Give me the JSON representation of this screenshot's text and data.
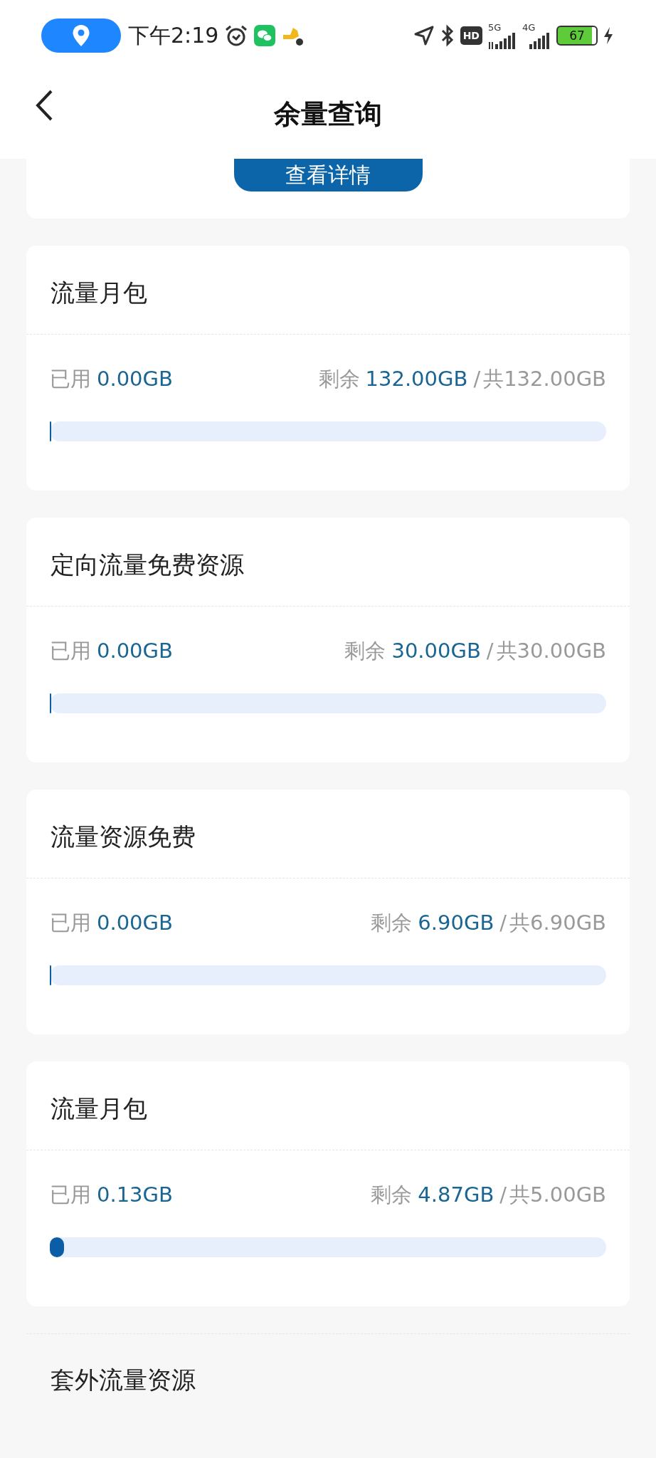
{
  "status_bar": {
    "time": "下午2:19",
    "network_5g": "5G",
    "network_4g": "4G",
    "hd": "HD",
    "battery": "67"
  },
  "header": {
    "title": "余量查询"
  },
  "top_card": {
    "button": "查看详情"
  },
  "cards": [
    {
      "title": "流量月包",
      "used_label": "已用",
      "used": "0.00GB",
      "remaining_label": "剩余",
      "remaining": "132.00GB",
      "separator": "/",
      "total": "共132.00GB",
      "level": 0
    },
    {
      "title": "定向流量免费资源",
      "used_label": "已用",
      "used": "0.00GB",
      "remaining_label": "剩余",
      "remaining": "30.00GB",
      "separator": "/",
      "total": "共30.00GB",
      "level": 0
    },
    {
      "title": "流量资源免费",
      "used_label": "已用",
      "used": "0.00GB",
      "remaining_label": "剩余",
      "remaining": "6.90GB",
      "separator": "/",
      "total": "共6.90GB",
      "level": 0
    },
    {
      "title": "流量月包",
      "used_label": "已用",
      "used": "0.13GB",
      "remaining_label": "剩余",
      "remaining": "4.87GB",
      "separator": "/",
      "total": "共5.00GB",
      "level": 0.026
    }
  ],
  "section": {
    "title": "套外流量资源"
  }
}
